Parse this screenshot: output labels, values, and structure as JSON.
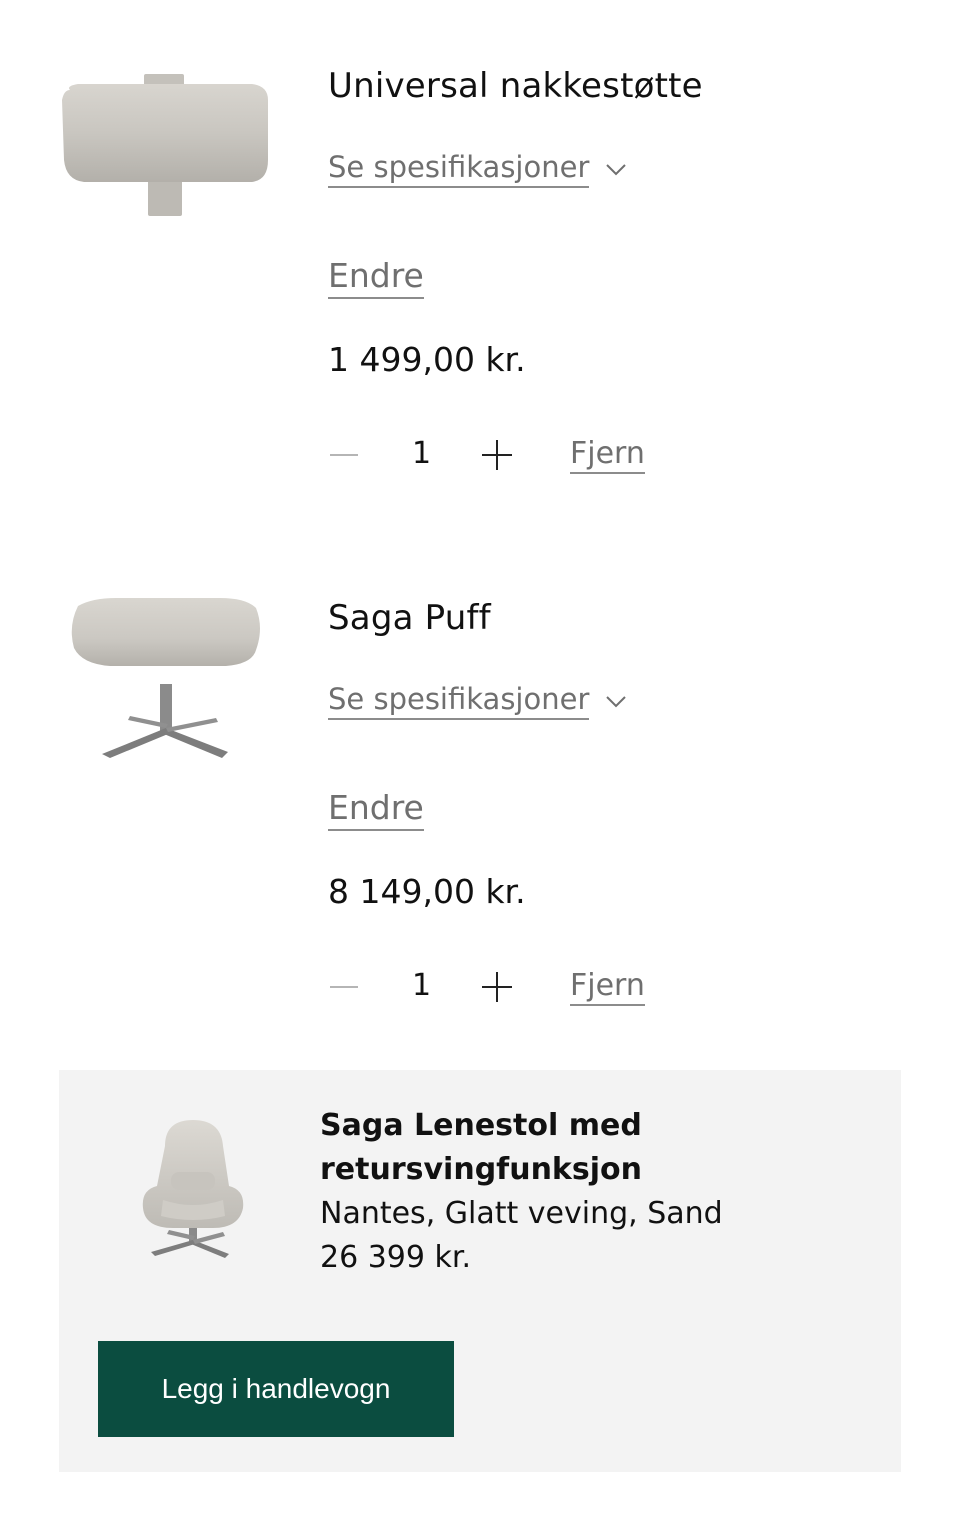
{
  "cart": {
    "items": [
      {
        "name": "Universal nakkestøtte",
        "specs_label": "Se spesifikasjoner",
        "edit_label": "Endre",
        "price": "1 499,00 kr.",
        "quantity": "1",
        "remove_label": "Fjern"
      },
      {
        "name": "Saga Puff",
        "specs_label": "Se spesifikasjoner",
        "edit_label": "Endre",
        "price": "8 149,00 kr.",
        "quantity": "1",
        "remove_label": "Fjern"
      }
    ]
  },
  "upsell": {
    "title": "Saga Lenestol med retursvingfunksjon",
    "variant": "Nantes, Glatt veving, Sand",
    "price": "26 399 kr.",
    "button_label": "Legg i handlevogn"
  },
  "colors": {
    "button_bg": "#0b4d40",
    "panel_bg": "#f3f3f3",
    "muted_text": "#6f6f6f",
    "fabric": "#cfccc6"
  },
  "icons": {
    "specs_toggle": "chevron-down-icon",
    "decrease": "minus-icon",
    "increase": "plus-icon"
  }
}
